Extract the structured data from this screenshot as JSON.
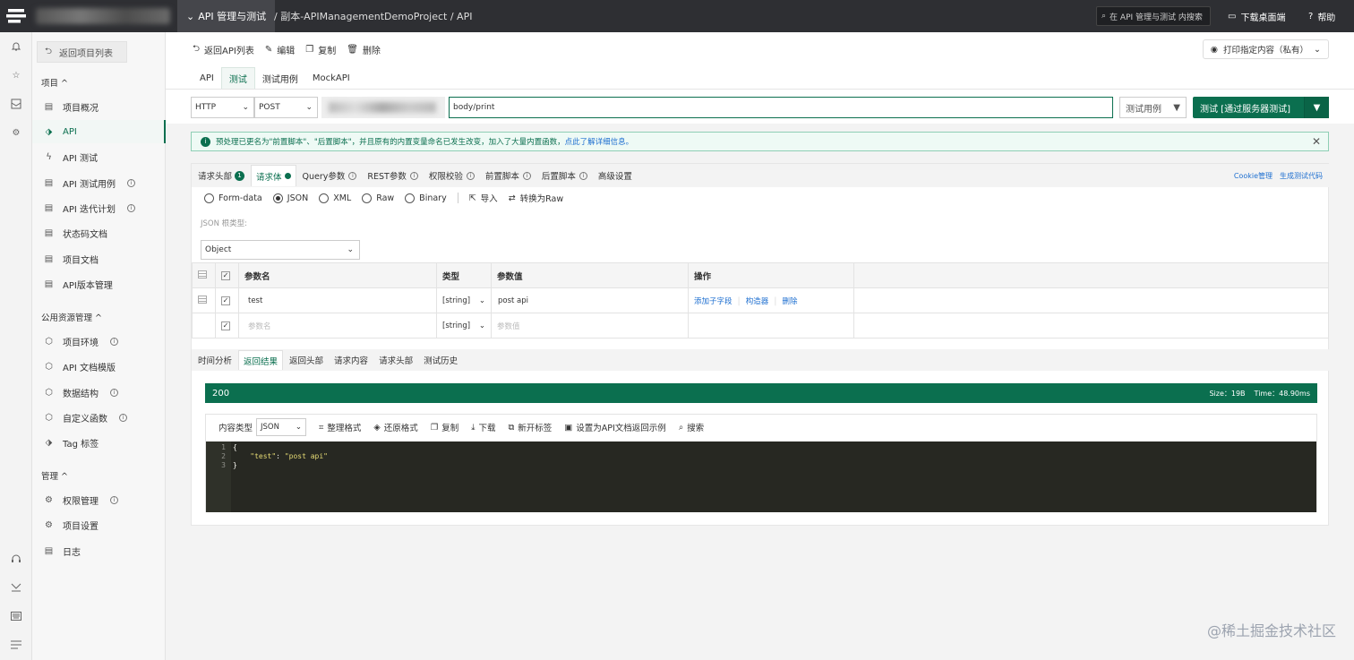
{
  "topbar": {
    "project_menu": "API 管理与测试",
    "breadcrumb": "/ 副本-APIManagementDemoProject / API",
    "search_placeholder": "在 API 管理与测试 内搜索",
    "download_label": "下载桌面端",
    "help_label": "帮助"
  },
  "sidebar": {
    "back_label": "返回项目列表",
    "section_project": "项目 ^",
    "items_project": [
      {
        "label": "项目概况",
        "icon": "doc-icon"
      },
      {
        "label": "API",
        "icon": "tag-icon"
      },
      {
        "label": "API 测试",
        "icon": "bolt-icon"
      },
      {
        "label": "API 测试用例",
        "icon": "doc-icon"
      },
      {
        "label": "API 迭代计划",
        "icon": "doc-icon"
      },
      {
        "label": "状态码文档",
        "icon": "doc-icon"
      },
      {
        "label": "项目文档",
        "icon": "doc-icon"
      },
      {
        "label": "API版本管理",
        "icon": "doc-icon"
      }
    ],
    "section_public": "公用资源管理 ^",
    "items_public": [
      {
        "label": "项目环境",
        "icon": "cube-icon"
      },
      {
        "label": "API 文档模版",
        "icon": "cube-icon"
      },
      {
        "label": "数据结构",
        "icon": "cube-icon"
      },
      {
        "label": "自定义函数",
        "icon": "cube-icon"
      },
      {
        "label": "Tag 标签",
        "icon": "tag-icon"
      }
    ],
    "section_manage": "管理 ^",
    "items_manage": [
      {
        "label": "权限管理",
        "icon": "gear-icon"
      },
      {
        "label": "项目设置",
        "icon": "gear-icon"
      },
      {
        "label": "日志",
        "icon": "doc-icon"
      }
    ]
  },
  "toolbar": {
    "back_api_list": "返回API列表",
    "edit": "编辑",
    "copy": "复制",
    "delete": "删除",
    "print": "打印指定内容（私有）"
  },
  "tabs_top": [
    "API",
    "测试",
    "测试用例",
    "MockAPI"
  ],
  "request": {
    "protocol": "HTTP",
    "method": "POST",
    "url": "body/print",
    "testcase_select": "测试用例",
    "test_button": "测试 [通过服务器测试]"
  },
  "notice": {
    "text": "预处理已更名为\"前置脚本\"、\"后置脚本\"，并且原有的内置变量命名已发生改变，加入了大量内置函数，",
    "link": "点此了解详细信息。"
  },
  "param_tabs": [
    {
      "label": "请求头部",
      "marker": "1"
    },
    {
      "label": "请求体",
      "marker": "dot"
    },
    {
      "label": "Query参数",
      "marker": "info"
    },
    {
      "label": "REST参数",
      "marker": "info"
    },
    {
      "label": "权限校验",
      "marker": "info"
    },
    {
      "label": "前置脚本",
      "marker": "info"
    },
    {
      "label": "后置脚本",
      "marker": "info"
    },
    {
      "label": "高级设置",
      "marker": ""
    }
  ],
  "tab_links": {
    "cookie": "Cookie管理",
    "gen_code": "生成测试代码"
  },
  "body_types": [
    "Form-data",
    "JSON",
    "XML",
    "Raw",
    "Binary"
  ],
  "body_type_selected": "JSON",
  "body_actions": {
    "import": "导入",
    "to_raw": "转换为Raw"
  },
  "json_model_label": "JSON 根类型:",
  "json_root": "Object",
  "table": {
    "headers": [
      "参数名",
      "类型",
      "参数值",
      "操作"
    ],
    "rows": [
      {
        "name": "test",
        "type": "[string]",
        "value": "post api",
        "actions": [
          "添加子字段",
          "构造器",
          "删除"
        ]
      }
    ],
    "new_row": {
      "name_placeholder": "参数名",
      "type": "[string]",
      "value_placeholder": "参数值"
    }
  },
  "result_tabs": [
    "时间分析",
    "返回结果",
    "返回头部",
    "请求内容",
    "请求头部",
    "测试历史"
  ],
  "result_tab_active": "返回结果",
  "status": {
    "code": "200",
    "size": "Size：19B",
    "time": "Time：48.90ms"
  },
  "response_toolbar": {
    "content_type_label": "内容类型",
    "content_type": "JSON",
    "format": "整理格式",
    "restore": "还原格式",
    "copy": "复制",
    "download": "下载",
    "new_tab": "新开标签",
    "set_example": "设置为API文档返回示例",
    "search": "搜索"
  },
  "response_lines": [
    "1",
    "2",
    "3"
  ],
  "response_code": {
    "open": "{",
    "key": "\"test\"",
    "sep": ": ",
    "value": "\"post api\"",
    "close": "}"
  },
  "watermark": "@稀土掘金技术社区",
  "colors": {
    "accent": "#0b6f4f",
    "topbar": "#2e2f33",
    "link": "#1e6fd0"
  }
}
